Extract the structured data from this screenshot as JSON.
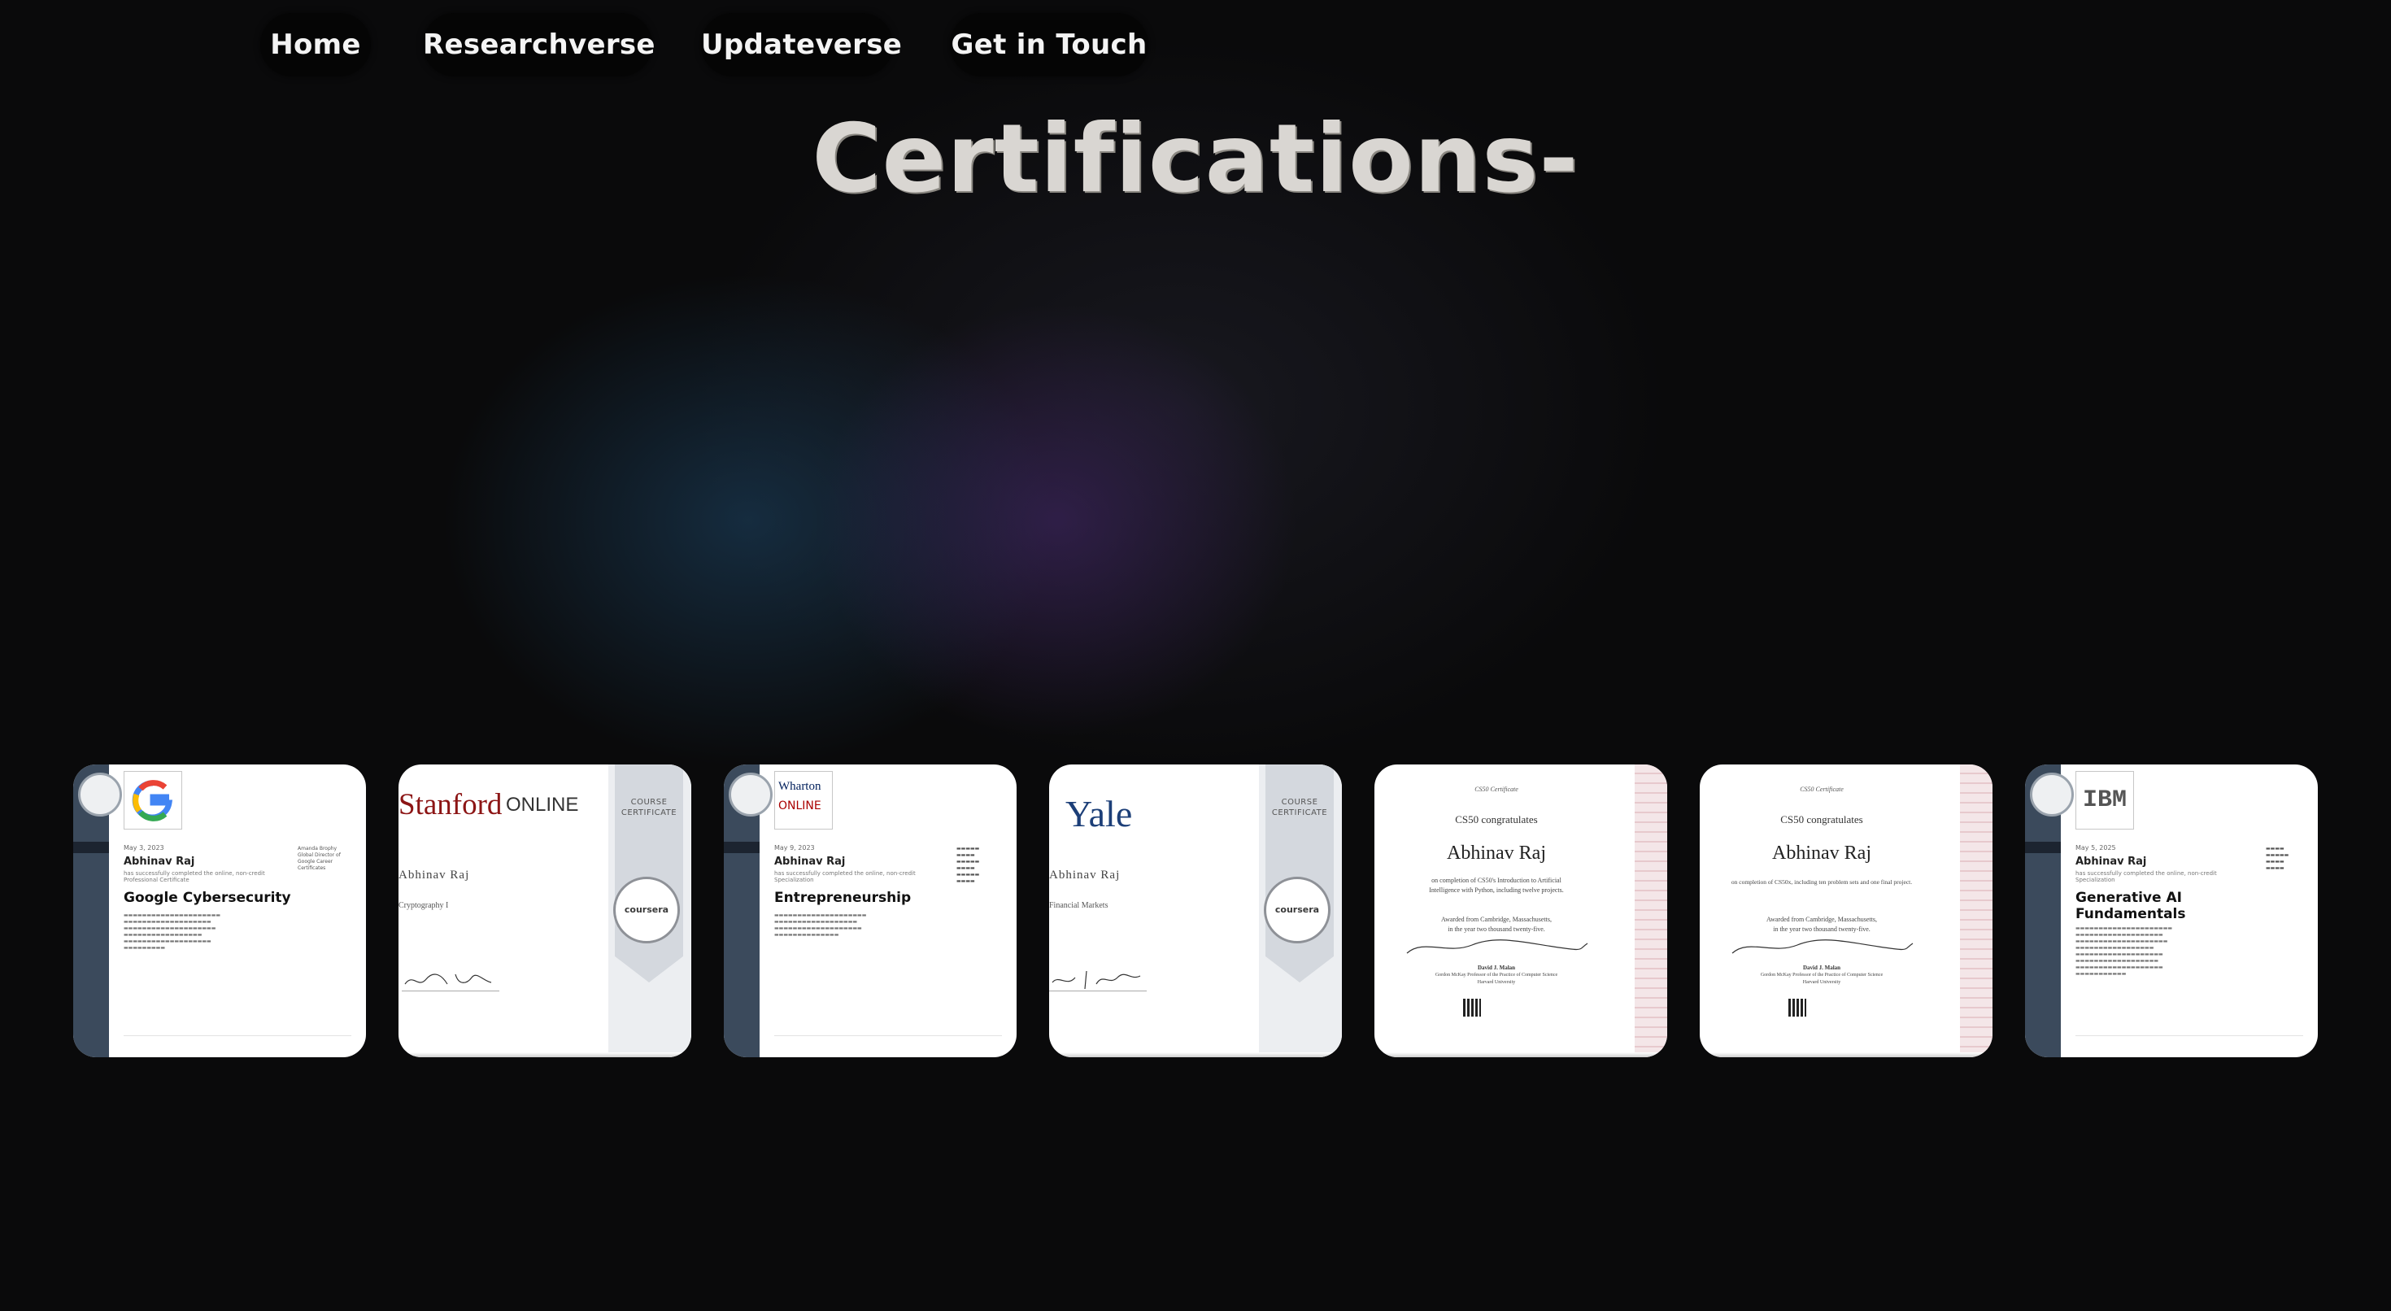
{
  "nav": {
    "home": "Home",
    "research": "Researchverse",
    "update": "Updateverse",
    "contact": "Get in Touch"
  },
  "page_title": "Certifications-",
  "certificates": [
    {
      "issuer_logo": "google-logo-icon",
      "date": "May 3, 2023",
      "name": "Abhinav Raj",
      "subtitle": "has successfully completed the online, non-credit Professional Certificate",
      "course": "Google Cybersecurity",
      "signer": "Amanda Brophy\nGlobal Director of\nGoogle Career\nCertificates"
    },
    {
      "brand": "Stanford",
      "brand_suffix": "ONLINE",
      "panel_label": "COURSE\nCERTIFICATE",
      "seal": "coursera",
      "name": "Abhinav Raj",
      "course": "Cryptography I"
    },
    {
      "brand_line1": "Wharton",
      "brand_line2": "ONLINE",
      "date": "May 9, 2023",
      "name": "Abhinav Raj",
      "subtitle": "has successfully completed the online, non-credit Specialization",
      "course": "Entrepreneurship"
    },
    {
      "brand": "Yale",
      "panel_label": "COURSE\nCERTIFICATE",
      "seal": "coursera",
      "name": "Abhinav Raj",
      "course": "Financial Markets"
    },
    {
      "small_head": "CS50 Certificate",
      "congrats": "CS50 congratulates",
      "name": "Abhinav Raj",
      "line1": "on completion of CS50's Introduction to Artificial",
      "line2": "Intelligence with Python, including twelve projects.",
      "awarded1": "Awarded from Cambridge, Massachusetts,",
      "awarded2": "in the year two thousand twenty-five.",
      "signer": "David J. Malan",
      "signer_title": "Gordon McKay Professor of the Practice of Computer Science",
      "signer_org": "Harvard University"
    },
    {
      "small_head": "CS50 Certificate",
      "congrats": "CS50 congratulates",
      "name": "Abhinav Raj",
      "line1": "on completion of CS50x, including ten problem sets and one final project.",
      "awarded1": "Awarded from Cambridge, Massachusetts,",
      "awarded2": "in the year two thousand twenty-five.",
      "signer": "David J. Malan",
      "signer_title": "Gordon McKay Professor of the Practice of Computer Science",
      "signer_org": "Harvard University"
    },
    {
      "issuer_logo_text": "IBM",
      "date": "May 5, 2025",
      "name": "Abhinav Raj",
      "subtitle": "has successfully completed the online, non-credit Specialization",
      "course": "Generative AI Fundamentals"
    }
  ]
}
